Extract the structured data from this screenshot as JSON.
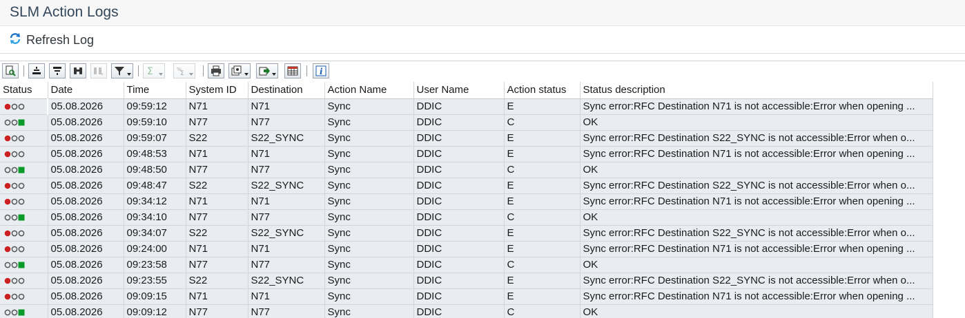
{
  "window": {
    "title": "SLM Action Logs"
  },
  "toolbar": {
    "refresh_label": "Refresh Log"
  },
  "table": {
    "columns": [
      "Status",
      "Date",
      "Time",
      "System ID",
      "Destination",
      "Action Name",
      "User Name",
      "Action status",
      "Status description"
    ],
    "rows": [
      {
        "status": "error",
        "date": "05.08.2026",
        "time": "09:59:12",
        "system": "N71",
        "destination": "N71",
        "action": "Sync",
        "user": "DDIC",
        "action_status": "E",
        "description": "Sync error:RFC Destination N71 is not accessible:Error when opening ..."
      },
      {
        "status": "ok",
        "date": "05.08.2026",
        "time": "09:59:10",
        "system": "N77",
        "destination": "N77",
        "action": "Sync",
        "user": "DDIC",
        "action_status": "C",
        "description": "OK"
      },
      {
        "status": "error",
        "date": "05.08.2026",
        "time": "09:59:07",
        "system": "S22",
        "destination": "S22_SYNC",
        "action": "Sync",
        "user": "DDIC",
        "action_status": "E",
        "description": "Sync error:RFC Destination S22_SYNC is not accessible:Error when o..."
      },
      {
        "status": "error",
        "date": "05.08.2026",
        "time": "09:48:53",
        "system": "N71",
        "destination": "N71",
        "action": "Sync",
        "user": "DDIC",
        "action_status": "E",
        "description": "Sync error:RFC Destination N71 is not accessible:Error when opening ..."
      },
      {
        "status": "ok",
        "date": "05.08.2026",
        "time": "09:48:50",
        "system": "N77",
        "destination": "N77",
        "action": "Sync",
        "user": "DDIC",
        "action_status": "C",
        "description": "OK"
      },
      {
        "status": "error",
        "date": "05.08.2026",
        "time": "09:48:47",
        "system": "S22",
        "destination": "S22_SYNC",
        "action": "Sync",
        "user": "DDIC",
        "action_status": "E",
        "description": "Sync error:RFC Destination S22_SYNC is not accessible:Error when o..."
      },
      {
        "status": "error",
        "date": "05.08.2026",
        "time": "09:34:12",
        "system": "N71",
        "destination": "N71",
        "action": "Sync",
        "user": "DDIC",
        "action_status": "E",
        "description": "Sync error:RFC Destination N71 is not accessible:Error when opening ..."
      },
      {
        "status": "ok",
        "date": "05.08.2026",
        "time": "09:34:10",
        "system": "N77",
        "destination": "N77",
        "action": "Sync",
        "user": "DDIC",
        "action_status": "C",
        "description": "OK"
      },
      {
        "status": "error",
        "date": "05.08.2026",
        "time": "09:34:07",
        "system": "S22",
        "destination": "S22_SYNC",
        "action": "Sync",
        "user": "DDIC",
        "action_status": "E",
        "description": "Sync error:RFC Destination S22_SYNC is not accessible:Error when o..."
      },
      {
        "status": "error",
        "date": "05.08.2026",
        "time": "09:24:00",
        "system": "N71",
        "destination": "N71",
        "action": "Sync",
        "user": "DDIC",
        "action_status": "E",
        "description": "Sync error:RFC Destination N71 is not accessible:Error when opening ..."
      },
      {
        "status": "ok",
        "date": "05.08.2026",
        "time": "09:23:58",
        "system": "N77",
        "destination": "N77",
        "action": "Sync",
        "user": "DDIC",
        "action_status": "C",
        "description": "OK"
      },
      {
        "status": "error",
        "date": "05.08.2026",
        "time": "09:23:55",
        "system": "S22",
        "destination": "S22_SYNC",
        "action": "Sync",
        "user": "DDIC",
        "action_status": "E",
        "description": "Sync error:RFC Destination S22_SYNC is not accessible:Error when o..."
      },
      {
        "status": "error",
        "date": "05.08.2026",
        "time": "09:09:15",
        "system": "N71",
        "destination": "N71",
        "action": "Sync",
        "user": "DDIC",
        "action_status": "E",
        "description": "Sync error:RFC Destination N71 is not accessible:Error when opening ..."
      },
      {
        "status": "ok",
        "date": "05.08.2026",
        "time": "09:09:12",
        "system": "N77",
        "destination": "N77",
        "action": "Sync",
        "user": "DDIC",
        "action_status": "C",
        "description": "OK"
      }
    ]
  },
  "colors": {
    "error_light": "#cc1f1f",
    "ok_light": "#0a9a2a",
    "inactive_light": "#555555",
    "row_bg": "#e9edf1",
    "title_text": "#33475a"
  }
}
